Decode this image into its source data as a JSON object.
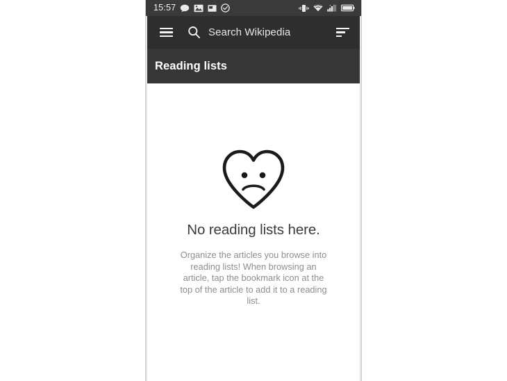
{
  "status_bar": {
    "time": "15:57",
    "left_icons": [
      {
        "name": "chat-bubble-icon"
      },
      {
        "name": "image-icon"
      },
      {
        "name": "screenshot-icon"
      },
      {
        "name": "check-circle-icon"
      }
    ],
    "right_icons": [
      {
        "name": "vibrate-icon"
      },
      {
        "name": "wifi-icon"
      },
      {
        "name": "cellular-signal-icon"
      },
      {
        "name": "battery-icon"
      }
    ]
  },
  "toolbar": {
    "menu_label": "Menu",
    "search_placeholder": "Search Wikipedia",
    "sort_label": "Sort"
  },
  "section": {
    "title": "Reading lists"
  },
  "empty_state": {
    "icon": "sad-heart-icon",
    "title": "No reading lists here.",
    "description": "Organize the articles you browse into reading lists! When browsing an article, tap the bookmark icon at the top of the article to add it to a reading list."
  },
  "colors": {
    "status_bar_bg": "#3a3a3a",
    "toolbar_bg": "#2e2e2e",
    "section_bg": "#363636",
    "content_bg": "#ffffff",
    "title_text": "#3b3b3b",
    "desc_text": "#8d8d8d",
    "icon_stroke": "#1a1a1a"
  }
}
